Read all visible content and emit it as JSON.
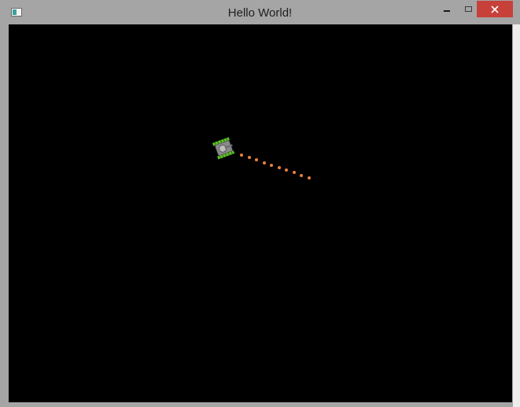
{
  "window": {
    "title": "Hello World!",
    "icon": "app-window-icon",
    "controls": {
      "minimize": "minimize-icon",
      "maximize": "maximize-icon",
      "close": "close-icon"
    },
    "close_color": "#c7403a",
    "frame_color": "#a5a5a5"
  },
  "game": {
    "background": "#000000",
    "player": {
      "sprite": "tank-icon",
      "body_color": "#8a8a8a",
      "track_color": "#5fbf2a"
    },
    "bullet_color": "#e8803a",
    "bullets_visible": 10
  }
}
